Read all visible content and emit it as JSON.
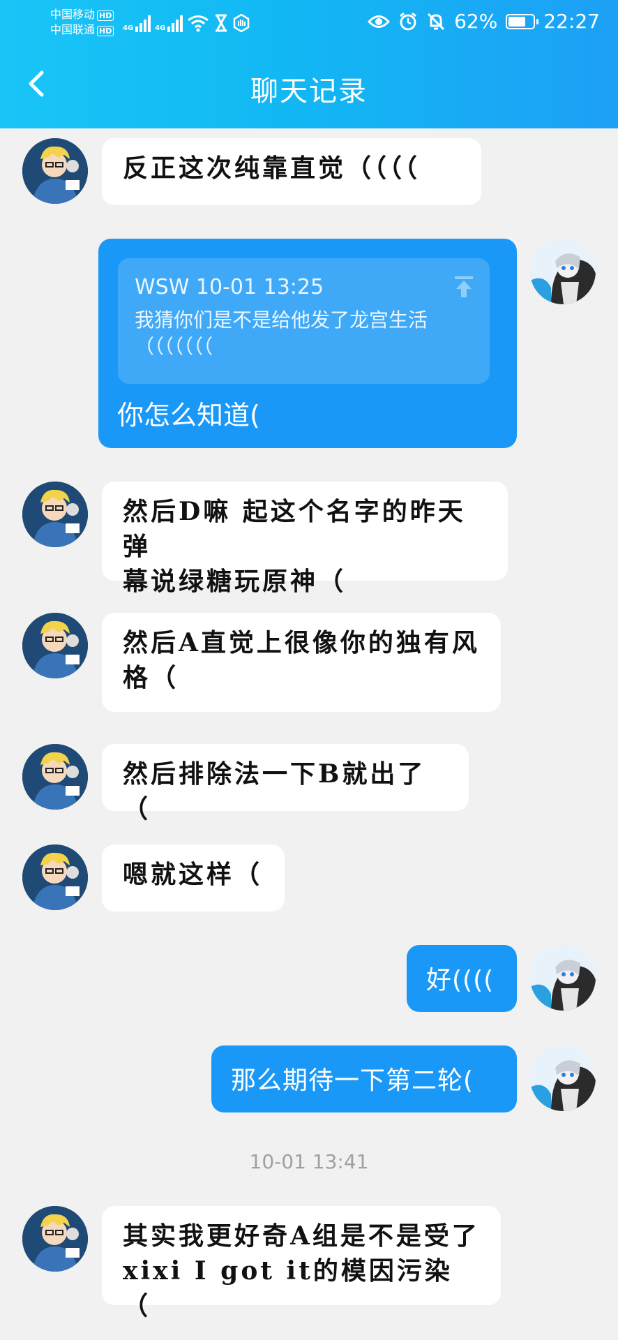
{
  "status_bar": {
    "carrier_1": "中国移动",
    "carrier_2": "中国联通",
    "hd_badge": "HD",
    "network_1": "4G",
    "network_2": "4G",
    "battery_text": "62%",
    "battery_level": 0.62,
    "time": "22:27"
  },
  "header": {
    "title": "聊天记录"
  },
  "messages": [
    {
      "side": "in",
      "text": "反正这次纯靠直觉（（（（"
    },
    {
      "side": "out",
      "quote": {
        "sender_time": "WSW 10-01 13:25",
        "text": "我猜你们是不是给他发了龙宫生活（（（（（（（"
      },
      "text": "你怎么知道("
    },
    {
      "side": "in",
      "line1": "然后D嘛 起这个名字的昨天弹",
      "line2": "幕说绿糖玩原神（"
    },
    {
      "side": "in",
      "line1": "然后A直觉上很像你的独有风",
      "line2": "格（"
    },
    {
      "side": "in",
      "text": "然后排除法一下B就出了（"
    },
    {
      "side": "in",
      "text": "嗯就这样（"
    },
    {
      "side": "out",
      "text": "好(((("
    },
    {
      "side": "out",
      "text": "那么期待一下第二轮("
    }
  ],
  "divider_time": "10-01 13:41",
  "last_message": {
    "side": "in",
    "line1": "其实我更好奇A组是不是受了",
    "line2": "xixi I got it的模因污染（"
  },
  "colors": {
    "header_start": "#19c5f7",
    "header_end": "#1da0f5",
    "outgoing_bubble": "#1a98f7",
    "quote_block": "#3fa9f8",
    "background": "#f1f1f1"
  }
}
